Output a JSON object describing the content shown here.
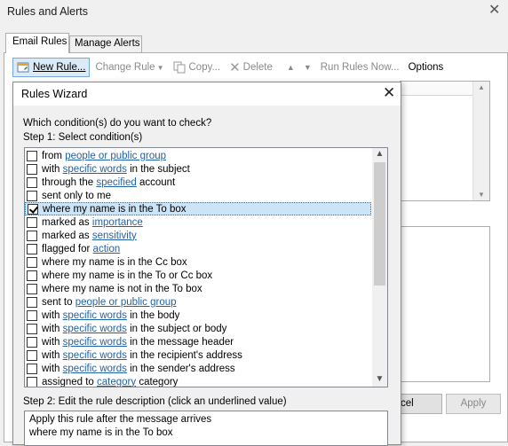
{
  "window": {
    "title": "Rules and Alerts",
    "close_glyph": "✕"
  },
  "tabs": [
    {
      "label": "Email Rules"
    },
    {
      "label": "Manage Alerts"
    }
  ],
  "toolbar": {
    "new_rule": "New Rule...",
    "change_rule": "Change Rule",
    "copy": "Copy...",
    "delete": "Delete",
    "run_rules": "Run Rules Now...",
    "options": "Options"
  },
  "buttons": {
    "ok_partial": "cel",
    "apply": "Apply"
  },
  "wizard": {
    "title": "Rules Wizard",
    "close_glyph": "✕",
    "question": "Which condition(s) do you want to check?",
    "step1": "Step 1: Select condition(s)",
    "step2": "Step 2: Edit the rule description (click an underlined value)",
    "conditions": [
      {
        "pre": "from ",
        "link": "people or public group",
        "post": "",
        "checked": false
      },
      {
        "pre": "with ",
        "link": "specific words",
        "post": " in the subject",
        "checked": false
      },
      {
        "pre": "through the ",
        "link": "specified",
        "post": " account",
        "checked": false
      },
      {
        "pre": "sent only to me",
        "link": "",
        "post": "",
        "checked": false
      },
      {
        "pre": "where my name is in the To box",
        "link": "",
        "post": "",
        "checked": true
      },
      {
        "pre": "marked as ",
        "link": "importance",
        "post": "",
        "checked": false
      },
      {
        "pre": "marked as ",
        "link": "sensitivity",
        "post": "",
        "checked": false
      },
      {
        "pre": "flagged for ",
        "link": "action",
        "post": "",
        "checked": false
      },
      {
        "pre": "where my name is in the Cc box",
        "link": "",
        "post": "",
        "checked": false
      },
      {
        "pre": "where my name is in the To or Cc box",
        "link": "",
        "post": "",
        "checked": false
      },
      {
        "pre": "where my name is not in the To box",
        "link": "",
        "post": "",
        "checked": false
      },
      {
        "pre": "sent to ",
        "link": "people or public group",
        "post": "",
        "checked": false
      },
      {
        "pre": "with ",
        "link": "specific words",
        "post": " in the body",
        "checked": false
      },
      {
        "pre": "with ",
        "link": "specific words",
        "post": " in the subject or body",
        "checked": false
      },
      {
        "pre": "with ",
        "link": "specific words",
        "post": " in the message header",
        "checked": false
      },
      {
        "pre": "with ",
        "link": "specific words",
        "post": " in the recipient's address",
        "checked": false
      },
      {
        "pre": "with ",
        "link": "specific words",
        "post": " in the sender's address",
        "checked": false
      },
      {
        "pre": "assigned to ",
        "link": "category",
        "post": " category",
        "checked": false
      }
    ],
    "description": [
      "Apply this rule after the message arrives",
      "where my name is in the To box"
    ]
  }
}
